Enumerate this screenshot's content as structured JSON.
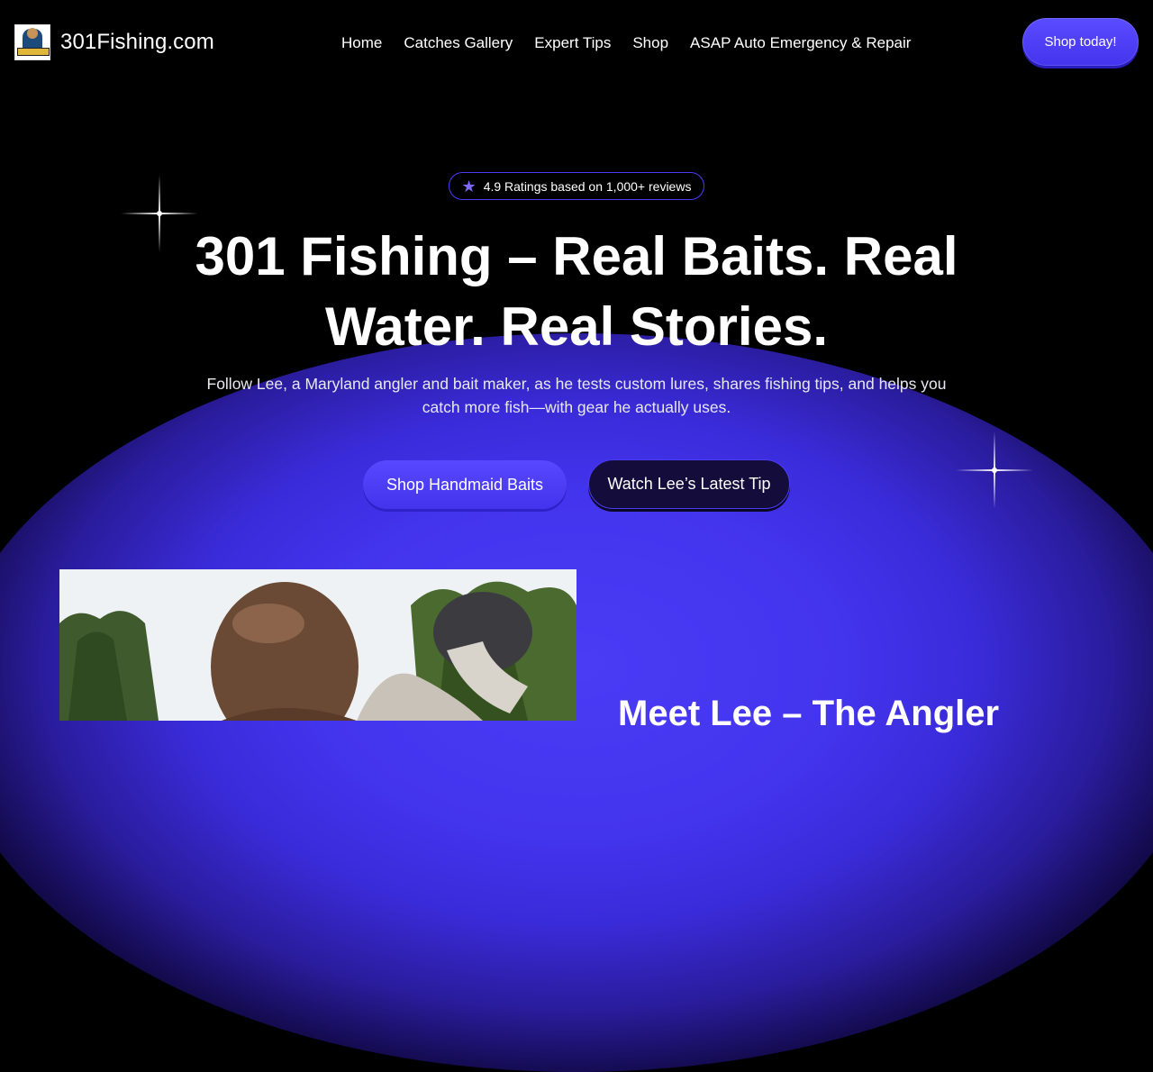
{
  "header": {
    "site_name": "301Fishing.com",
    "nav": [
      "Home",
      "Catches Gallery",
      "Expert Tips",
      "Shop",
      "ASAP Auto Emergency & Repair"
    ],
    "cta_label": "Shop today!"
  },
  "hero": {
    "rating_text": "4.9 Ratings based on 1,000+ reviews",
    "title": "301 Fishing – Real Baits. Real Water. Real Stories.",
    "subtitle": "Follow Lee, a Maryland angler and bait maker, as he tests custom lures, shares fishing tips, and helps you catch more fish—with gear he actually uses.",
    "primary_button": "Shop Handmaid Baits",
    "secondary_button": "Watch Lee’s Latest Tip"
  },
  "about": {
    "heading": "Meet Lee – The Angler"
  },
  "icons": {
    "rating": "star-icon",
    "decor": "sparkle-icon"
  },
  "colors": {
    "accent": "#4a3cf5",
    "background": "#000000",
    "text": "#ffffff"
  }
}
